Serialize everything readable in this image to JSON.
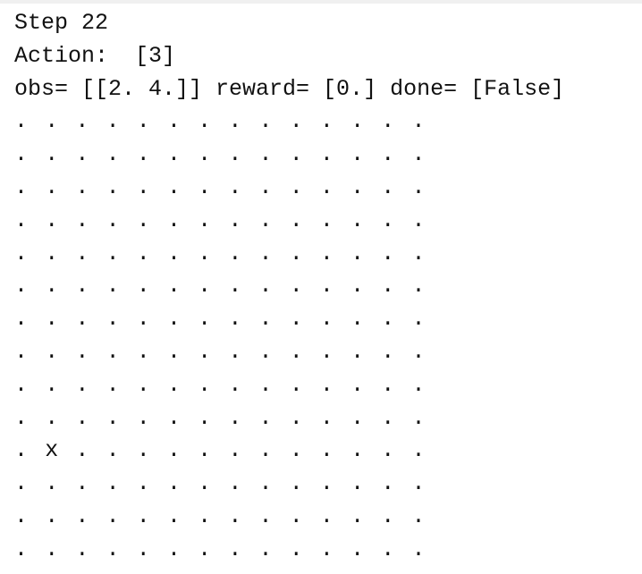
{
  "header": {
    "step_line": "Step 22",
    "action_line": "Action:  [3]",
    "obs_line": "obs= [[2. 4.]] reward= [0.] done= [False]"
  },
  "grid": {
    "rows": [
      [
        ".",
        ".",
        ".",
        ".",
        ".",
        ".",
        ".",
        ".",
        ".",
        ".",
        ".",
        ".",
        ".",
        "."
      ],
      [
        ".",
        ".",
        ".",
        ".",
        ".",
        ".",
        ".",
        ".",
        ".",
        ".",
        ".",
        ".",
        ".",
        "."
      ],
      [
        ".",
        ".",
        ".",
        ".",
        ".",
        ".",
        ".",
        ".",
        ".",
        ".",
        ".",
        ".",
        ".",
        "."
      ],
      [
        ".",
        ".",
        ".",
        ".",
        ".",
        ".",
        ".",
        ".",
        ".",
        ".",
        ".",
        ".",
        ".",
        "."
      ],
      [
        ".",
        ".",
        ".",
        ".",
        ".",
        ".",
        ".",
        ".",
        ".",
        ".",
        ".",
        ".",
        ".",
        "."
      ],
      [
        ".",
        ".",
        ".",
        ".",
        ".",
        ".",
        ".",
        ".",
        ".",
        ".",
        ".",
        ".",
        ".",
        "."
      ],
      [
        ".",
        ".",
        ".",
        ".",
        ".",
        ".",
        ".",
        ".",
        ".",
        ".",
        ".",
        ".",
        ".",
        "."
      ],
      [
        ".",
        ".",
        ".",
        ".",
        ".",
        ".",
        ".",
        ".",
        ".",
        ".",
        ".",
        ".",
        ".",
        "."
      ],
      [
        ".",
        ".",
        ".",
        ".",
        ".",
        ".",
        ".",
        ".",
        ".",
        ".",
        ".",
        ".",
        ".",
        "."
      ],
      [
        ".",
        ".",
        ".",
        ".",
        ".",
        ".",
        ".",
        ".",
        ".",
        ".",
        ".",
        ".",
        ".",
        "."
      ],
      [
        ".",
        "x",
        ".",
        ".",
        ".",
        ".",
        ".",
        ".",
        ".",
        ".",
        ".",
        ".",
        ".",
        "."
      ],
      [
        ".",
        ".",
        ".",
        ".",
        ".",
        ".",
        ".",
        ".",
        ".",
        ".",
        ".",
        ".",
        ".",
        "."
      ],
      [
        ".",
        ".",
        ".",
        ".",
        ".",
        ".",
        ".",
        ".",
        ".",
        ".",
        ".",
        ".",
        ".",
        "."
      ],
      [
        ".",
        ".",
        ".",
        ".",
        ".",
        ".",
        ".",
        ".",
        ".",
        ".",
        ".",
        ".",
        ".",
        "."
      ]
    ]
  }
}
